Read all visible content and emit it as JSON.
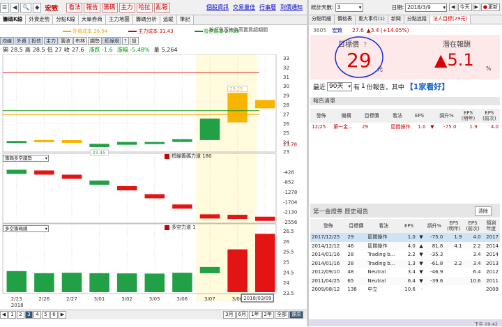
{
  "stock": {
    "code": "3605",
    "name": "宏致"
  },
  "toolbar": {
    "buttons": [
      "看法",
      "報告",
      "籌碼",
      "主力",
      "哈拉",
      "亂報"
    ],
    "links": [
      "個股資訊",
      "交易量佳",
      "行事曆",
      "到價通知"
    ]
  },
  "chart_tabs": [
    "籌碼K線",
    "外資走勢",
    "分點K線",
    "大單券商",
    "主力地圖",
    "籌碼分析",
    "追蹤",
    "筆記"
  ],
  "note_text": "粉紅色區塊為高賣買超期間",
  "legend": {
    "foreign": "外資成本 26.94",
    "main": "主力成本 31.43",
    "trust": "投信成本 27.35"
  },
  "sub_buttons": [
    "均線",
    "外資",
    "投信",
    "主力",
    "籌波",
    "布林",
    "趨勢",
    "紅綠燈"
  ],
  "sub_extra": [
    "?",
    "設"
  ],
  "ohlc": {
    "open_l": "開",
    "open": "28.5",
    "high_l": "高",
    "high": "28.5",
    "low_l": "低",
    "low": "27",
    "close_l": "收",
    "close": "27.6",
    "chg": "漲跌 -1.6",
    "pct": "漲幅 -5.48%",
    "vol_l": "量",
    "vol": "5,264"
  },
  "main_axis": [
    "33",
    "32",
    "31",
    "30",
    "29",
    "28",
    "27",
    "26",
    "25",
    "24",
    "23.78",
    "23"
  ],
  "price_labels": {
    "high": "29.25",
    "low": "23.45"
  },
  "panel2": {
    "select": "籌碼多空趨勢",
    "legend": "短線籌碼力道 180",
    "axis": [
      "-426",
      "-852",
      "-1278",
      "-1704",
      "-2130",
      "-2556"
    ]
  },
  "panel3": {
    "select": "多空籌碼線",
    "legend": "多空力道 1",
    "axis": [
      "26.5",
      "26",
      "25.5",
      "25",
      "24.5",
      "24",
      "23.5"
    ]
  },
  "dates": [
    "2/23",
    "2/26",
    "2/27",
    "3/01",
    "3/02",
    "3/05",
    "3/06",
    "3/07",
    "3/08"
  ],
  "date_year": "2018",
  "date_current": "2018/03/09",
  "bottom": {
    "pages": [
      "1",
      "2",
      "3",
      "4",
      "5",
      "6"
    ],
    "ranges": [
      "3月",
      "6月",
      "1年",
      "2年",
      "全部",
      "還原"
    ]
  },
  "right": {
    "stats_label": "統計天數:",
    "stats_value": "3",
    "date_label": "日期:",
    "date_value": "2018/3/9",
    "today": "今天",
    "refresh": "更新",
    "tabs": [
      "分點明細",
      "價格表",
      "重大事件(1)",
      "新聞",
      "分點追蹤",
      "法人目標(29元)"
    ],
    "header": {
      "price": "27.6",
      "change": "▲3.4 (+14.05%)"
    },
    "target_label": "目標價",
    "target_help": "?",
    "potential_label": "潛在報酬",
    "target": "29",
    "unit": "元",
    "potential": "▲5.1",
    "pct": "%",
    "recent_pre": "最近",
    "recent_select": "90天",
    "recent_mid": "有",
    "recent_count": "1",
    "recent_post": "份報告，其中",
    "recent_good": "【1家看好】",
    "report_title": "報告清單",
    "report_head": [
      "發佈",
      "機構",
      "目標價",
      "看法",
      "EPS",
      "",
      "調升%",
      "EPS\n(明年)",
      "EPS\n(前次)"
    ],
    "report_rows": [
      [
        "12/25",
        "第一金...",
        "29",
        "區間操作",
        "1.0",
        "▼",
        "-75.0",
        "1.9",
        "4.0"
      ]
    ],
    "hist_title": "第一金證券 歷史報告",
    "clear": "清除",
    "hist_head": [
      "發佈",
      "目標價",
      "看法",
      "EPS",
      "",
      "調升%",
      "EPS\n(明年)",
      "EPS\n(前次)",
      "預測\n年度"
    ],
    "hist_rows": [
      [
        "2017/12/25",
        "29",
        "區間操作",
        "1.0",
        "▼",
        "-75.0",
        "1.9",
        "4.0",
        "2017"
      ],
      [
        "2014/12/12",
        "46",
        "區間操作",
        "4.0",
        "▲",
        "81.8",
        "4.1",
        "2.2",
        "2014"
      ],
      [
        "2014/01/16",
        "28",
        "Trading b...",
        "2.2",
        "▼",
        "-35.3",
        "",
        "3.4",
        "2014"
      ],
      [
        "2014/01/16",
        "28",
        "Trading b...",
        "1.3",
        "▼",
        "-61.8",
        "2.2",
        "3.4",
        "2013"
      ],
      [
        "2012/09/10",
        "48",
        "Neutral",
        "3.4",
        "▼",
        "-46.9",
        "",
        "6.4",
        "2012"
      ],
      [
        "2011/04/25",
        "65",
        "Neutral",
        "6.4",
        "▼",
        "-39.6",
        "",
        "10.6",
        "2011"
      ],
      [
        "2009/08/12",
        "138",
        "中立",
        "10.6",
        "-",
        "",
        "",
        "",
        "2009"
      ]
    ],
    "status_time": "下午 09:42"
  },
  "chart_data": [
    {
      "type": "candlestick",
      "categories": [
        "2/23",
        "2/26",
        "2/27",
        "3/01",
        "3/02",
        "3/05",
        "3/06",
        "3/07",
        "3/08",
        "3/09"
      ],
      "candles": [
        {
          "o": 24.1,
          "c": 23.9,
          "col": "green"
        },
        {
          "o": 24.2,
          "c": 24.0,
          "col": "orange"
        },
        {
          "o": 24.2,
          "c": 23.9,
          "col": "orange"
        },
        {
          "o": 23.8,
          "c": 23.45,
          "col": "green"
        },
        {
          "o": 24.0,
          "c": 23.7,
          "col": "green"
        },
        {
          "o": 24.0,
          "c": 23.8,
          "col": "green"
        },
        {
          "o": 24.3,
          "c": 24.0,
          "col": "green"
        },
        {
          "o": 26.5,
          "c": 24.2,
          "col": "green"
        },
        {
          "o": 29.25,
          "c": 26.1,
          "col": "orange"
        },
        {
          "o": 28.5,
          "c": 27.6,
          "col": "orange"
        }
      ],
      "ylim": [
        23,
        33.3
      ],
      "cost_lines": {
        "foreign": 26.94,
        "main": 31.43,
        "trust": 27.35
      }
    },
    {
      "type": "bar",
      "values": [
        -400,
        -430,
        -610,
        -860,
        -1100,
        -1440,
        -1880,
        -2300,
        -2320,
        -2400
      ],
      "colors": [
        "green",
        "red",
        "red",
        "green",
        "red",
        "red",
        "red",
        "red",
        "red",
        "red"
      ],
      "ylim": [
        0,
        -2556
      ]
    },
    {
      "type": "bar",
      "values": [
        24.55,
        24.45,
        24.47,
        24.45,
        24.44,
        24.43,
        24.47,
        24.75,
        25.6,
        26.35
      ],
      "colors": [
        "green",
        "green",
        "green",
        "green",
        "green",
        "green",
        "green",
        "green",
        "red",
        "red"
      ],
      "ylim": [
        23.5,
        26.8
      ]
    }
  ]
}
